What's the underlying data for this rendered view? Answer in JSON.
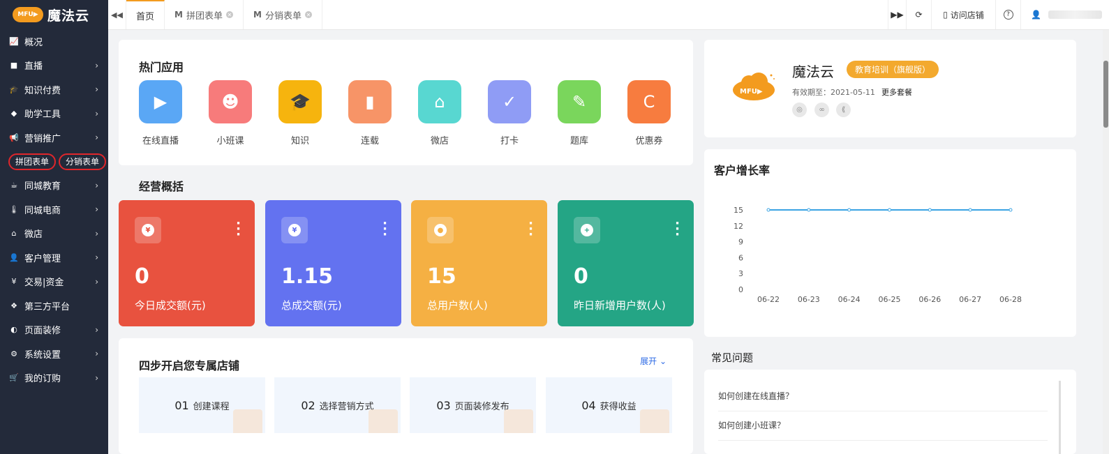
{
  "brand": {
    "badge": "MFU▶",
    "name": "魔法云"
  },
  "sidebar": {
    "items": [
      {
        "icon": "chart-line-icon",
        "glyph": "📈",
        "label": "概况",
        "chevron": false
      },
      {
        "icon": "video-camera-icon",
        "glyph": "■",
        "label": "直播",
        "chevron": true
      },
      {
        "icon": "graduation-cap-icon",
        "glyph": "🎓",
        "label": "知识付费",
        "chevron": true
      },
      {
        "icon": "eraser-icon",
        "glyph": "◆",
        "label": "助学工具",
        "chevron": true
      },
      {
        "icon": "bullhorn-icon",
        "glyph": "📢",
        "label": "营销推广",
        "chevron": true
      }
    ],
    "sub_items": [
      "拼团表单",
      "分销表单"
    ],
    "items_after": [
      {
        "icon": "coffee-icon",
        "glyph": "☕",
        "label": "同城教育",
        "chevron": true
      },
      {
        "icon": "thermometer-icon",
        "glyph": "🌡",
        "label": "同城电商",
        "chevron": true
      },
      {
        "icon": "home-icon",
        "glyph": "⌂",
        "label": "微店",
        "chevron": true
      },
      {
        "icon": "user-icon",
        "glyph": "👤",
        "label": "客户管理",
        "chevron": true
      },
      {
        "icon": "yen-icon",
        "glyph": "¥",
        "label": "交易|资金",
        "chevron": true
      },
      {
        "icon": "cubes-icon",
        "glyph": "❖",
        "label": "第三方平台",
        "chevron": false
      },
      {
        "icon": "dashboard-icon",
        "glyph": "◐",
        "label": "页面装修",
        "chevron": true
      },
      {
        "icon": "gear-icon",
        "glyph": "⚙",
        "label": "系统设置",
        "chevron": true
      },
      {
        "icon": "cart-icon",
        "glyph": "🛒",
        "label": "我的订购",
        "chevron": true
      }
    ]
  },
  "topbar": {
    "tabs": [
      {
        "label": "首页",
        "active": true,
        "closable": false
      },
      {
        "label": "拼团表单",
        "active": false,
        "closable": true
      },
      {
        "label": "分销表单",
        "active": false,
        "closable": true
      }
    ],
    "visit_store": "访问店铺",
    "help": "?"
  },
  "hot_apps": {
    "title": "热门应用",
    "apps": [
      {
        "label": "在线直播",
        "color": "#5aa7f5",
        "glyph": "▶"
      },
      {
        "label": "小班课",
        "color": "#f77b7b",
        "glyph": "☻"
      },
      {
        "label": "知识",
        "color": "#f6b40e",
        "glyph": "🎓"
      },
      {
        "label": "连载",
        "color": "#f79467",
        "glyph": "▮"
      },
      {
        "label": "微店",
        "color": "#58d7d1",
        "glyph": "⌂"
      },
      {
        "label": "打卡",
        "color": "#8f9cf5",
        "glyph": "✓"
      },
      {
        "label": "题库",
        "color": "#7ad65c",
        "glyph": "✎"
      },
      {
        "label": "优惠券",
        "color": "#f77c3f",
        "glyph": "C"
      }
    ]
  },
  "overview": {
    "title": "经营概括",
    "stats": [
      {
        "value": "0",
        "label": "今日成交额(元)",
        "color": "#e8523f",
        "glyph": "¥"
      },
      {
        "value": "1.15",
        "label": "总成交额(元)",
        "color": "#6372f0",
        "glyph": "¥"
      },
      {
        "value": "15",
        "label": "总用户数(人)",
        "color": "#f5b043",
        "glyph": "●"
      },
      {
        "value": "0",
        "label": "昨日新增用户数(人)",
        "color": "#24a585",
        "glyph": "+"
      }
    ]
  },
  "steps": {
    "title": "四步开启您专属店铺",
    "expand": "展开",
    "items": [
      {
        "num": "01",
        "label": "创建课程"
      },
      {
        "num": "02",
        "label": "选择营销方式"
      },
      {
        "num": "03",
        "label": "页面装修发布"
      },
      {
        "num": "04",
        "label": "获得收益"
      }
    ]
  },
  "profile": {
    "name": "魔法云",
    "badge": "教育培训（旗舰版）",
    "expire": "有效期至：2021-05-11",
    "more": "更多套餐"
  },
  "chart_data": {
    "type": "line",
    "title": "客户增长率",
    "categories": [
      "06-22",
      "06-23",
      "06-24",
      "06-25",
      "06-26",
      "06-27",
      "06-28"
    ],
    "series": [
      {
        "values": [
          15,
          15,
          15,
          15,
          15,
          15,
          15
        ]
      }
    ],
    "yticks": [
      0,
      3,
      6,
      9,
      12,
      15
    ],
    "ylim": [
      0,
      15
    ],
    "grid": false,
    "color": "#3aa3e3"
  },
  "faq": {
    "title": "常见问题",
    "items": [
      "如何创建在线直播？",
      "如何创建小班课？"
    ]
  }
}
